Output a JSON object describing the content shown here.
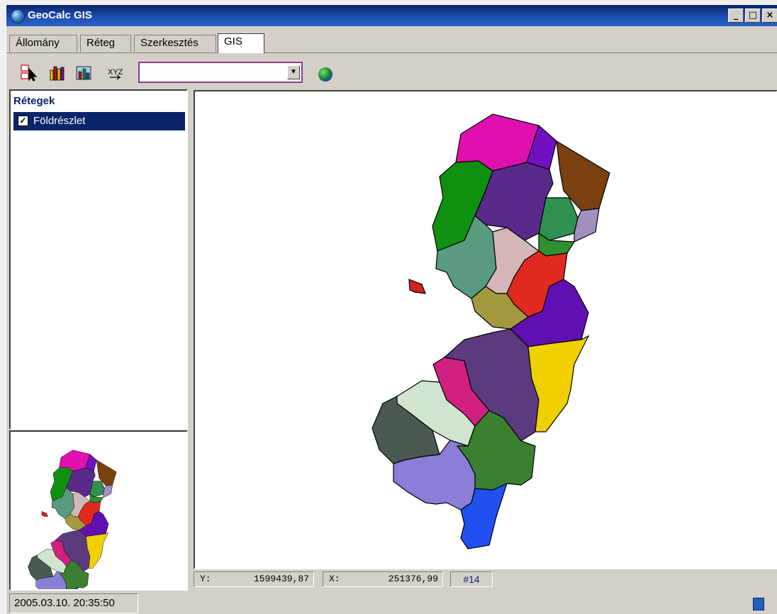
{
  "window": {
    "title": "GeoCalc GIS",
    "buttons": [
      "_",
      "□",
      "×"
    ]
  },
  "tabs": [
    "Állomány",
    "Réteg",
    "Szerkesztés",
    "GIS"
  ],
  "toolbar": {
    "icons": [
      "select-arrow-icon",
      "bar-chart-icon",
      "chart-map-icon",
      "xyz-icon",
      "globe-icon"
    ],
    "xyz_label": "XYZ",
    "combo_value": ""
  },
  "layers": {
    "title": "Rétegek",
    "items": [
      {
        "label": "Földrészlet",
        "checked": true
      }
    ]
  },
  "status": {
    "y_label": "Y:",
    "y_value": "1599439,87",
    "x_label": "X:",
    "x_value": "251376,99",
    "count": "#14",
    "datetime": "2005.03.10. 20:35:50"
  },
  "colors": {
    "titlebar": "#0a246a",
    "selection": "#0a246a",
    "panel_bg": "#d4d0c8"
  },
  "map": {
    "region_colors": [
      "#e010b0",
      "#7010c0",
      "#7a4010",
      "#109010",
      "#5a2a8a",
      "#2f9050",
      "#a090c0",
      "#5a9a80",
      "#d4b6b8",
      "#309030",
      "#e02a20",
      "#a39a40",
      "#6010b0",
      "#d02020",
      "#5c3a80",
      "#f0d000",
      "#d02080",
      "#d0e4d0",
      "#4a5a50",
      "#3a8030",
      "#8a7ed8",
      "#2050f0"
    ]
  }
}
